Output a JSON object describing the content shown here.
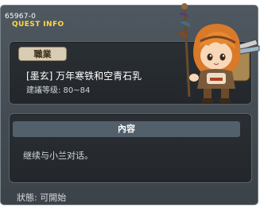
{
  "quest": {
    "id_label": "65967-0",
    "header": "QUEST INFO",
    "job_tab": "職業",
    "name": "[墨玄] 万年寒铁和空青石乳",
    "level_text": "建議等级: 80~84"
  },
  "content": {
    "header": "內容",
    "text": "继续与小兰对话。"
  },
  "status": {
    "text": "狀態:  可開始"
  },
  "npc": {
    "icon": "npc-character-icon"
  }
}
